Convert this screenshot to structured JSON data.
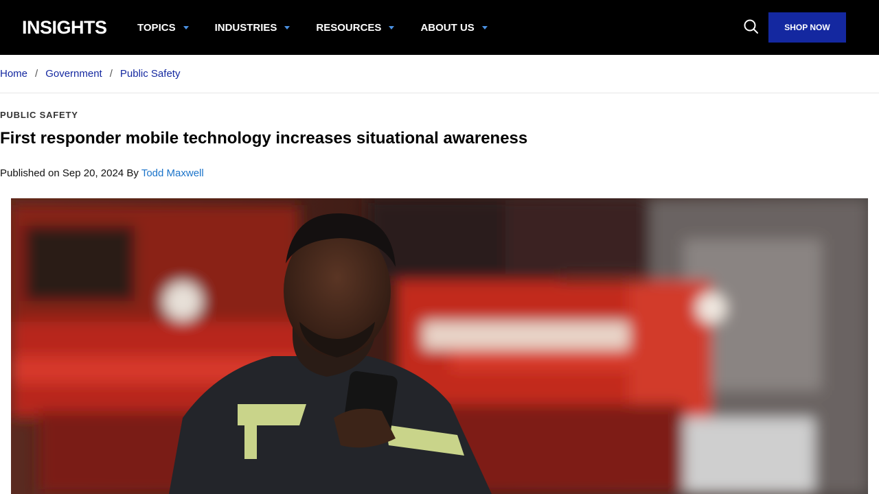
{
  "header": {
    "logo": "INSIGHTS",
    "nav": [
      {
        "label": "TOPICS"
      },
      {
        "label": "INDUSTRIES"
      },
      {
        "label": "RESOURCES"
      },
      {
        "label": "ABOUT US"
      }
    ],
    "search_icon": "search-icon",
    "shop_label": "SHOP NOW"
  },
  "breadcrumb": {
    "items": [
      "Home",
      "Government",
      "Public Safety"
    ],
    "separator": "/"
  },
  "article": {
    "category": "PUBLIC SAFETY",
    "title": "First responder mobile technology increases situational awareness",
    "published_prefix": "Published on Sep 20, 2024 By",
    "author": "Todd Maxwell"
  },
  "colors": {
    "topbar": "#000000",
    "shop_button": "#1428a0",
    "link": "#1428a0",
    "author_link": "#1a73c9",
    "caret": "#4a90e2"
  }
}
